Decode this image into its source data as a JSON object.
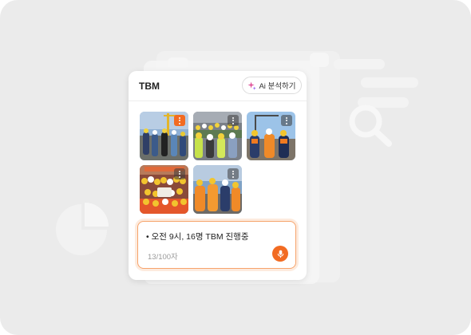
{
  "card": {
    "title": "TBM",
    "ai_button_label": "Ai 분석하기"
  },
  "photos": [
    {
      "name": "photo-1",
      "menu_accent": true
    },
    {
      "name": "photo-2",
      "menu_accent": false
    },
    {
      "name": "photo-3",
      "menu_accent": false
    },
    {
      "name": "photo-4",
      "menu_accent": false
    },
    {
      "name": "photo-5",
      "menu_accent": false
    }
  ],
  "input": {
    "text": "• 오전 9시, 16명 TBM 진행중",
    "char_count": "13/100자"
  },
  "colors": {
    "accent": "#f26b22",
    "focus_border": "#f6a36b",
    "background": "#ebebeb"
  },
  "icons": {
    "ai_button": "sparkle-icon",
    "photo_menu": "kebab-menu-icon",
    "input_action": "microphone-icon",
    "background": [
      "search-icon",
      "pie-chart-icon"
    ]
  }
}
